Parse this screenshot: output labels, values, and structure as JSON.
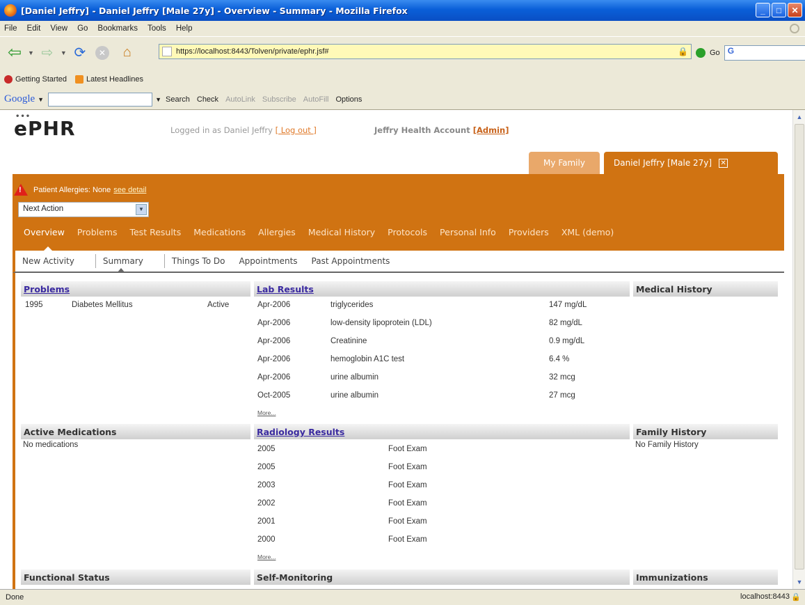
{
  "window": {
    "title": "[Daniel Jeffry] - Daniel Jeffry [Male 27y] - Overview - Summary - Mozilla Firefox",
    "min": "_",
    "max": "□",
    "close": "✕"
  },
  "menu": [
    "File",
    "Edit",
    "View",
    "Go",
    "Bookmarks",
    "Tools",
    "Help"
  ],
  "nav": {
    "url": "https://localhost:8443/Tolven/private/ephr.jsf#",
    "go_label": "Go",
    "search_value": "G"
  },
  "bookmarks": [
    "Getting Started",
    "Latest Headlines"
  ],
  "google_toolbar": {
    "logo": "Google",
    "items": [
      "Search",
      "Check",
      "AutoLink",
      "Subscribe",
      "AutoFill",
      "Options"
    ]
  },
  "app": {
    "logo": "ePHR",
    "logged_in_text": "Logged in as Daniel Jeffry",
    "logout_link": "[ Log out ]",
    "account_text": "Jeffry Health Account",
    "admin_link": "[Admin]",
    "tab_family": "My Family",
    "tab_patient": "Daniel Jeffry [Male 27y]",
    "allergy_text": "Patient Allergies: None",
    "allergy_link": "see detail",
    "next_action": "Next Action",
    "main_nav": [
      "Overview",
      "Problems",
      "Test Results",
      "Medications",
      "Allergies",
      "Medical History",
      "Protocols",
      "Personal Info",
      "Providers",
      "XML (demo)"
    ],
    "sub_nav": [
      "New Activity",
      "Summary",
      "Things To Do",
      "Appointments",
      "Past Appointments"
    ]
  },
  "problems": {
    "heading": "Problems",
    "rows": [
      {
        "year": "1995",
        "name": "Diabetes Mellitus",
        "status": "Active"
      }
    ]
  },
  "lab_results": {
    "heading": "Lab Results",
    "rows": [
      {
        "date": "Apr-2006",
        "test": "triglycerides",
        "value": "147 mg/dL"
      },
      {
        "date": "Apr-2006",
        "test": "low-density lipoprotein (LDL)",
        "value": "82 mg/dL"
      },
      {
        "date": "Apr-2006",
        "test": "Creatinine",
        "value": "0.9 mg/dL"
      },
      {
        "date": "Apr-2006",
        "test": "hemoglobin A1C test",
        "value": "6.4 %"
      },
      {
        "date": "Apr-2006",
        "test": "urine albumin",
        "value": "32 mcg"
      },
      {
        "date": "Oct-2005",
        "test": "urine albumin",
        "value": "27 mcg"
      }
    ],
    "more": "More..."
  },
  "medical_history": {
    "heading": "Medical History"
  },
  "active_medications": {
    "heading": "Active Medications",
    "text": "No medications"
  },
  "radiology": {
    "heading": "Radiology Results",
    "rows": [
      {
        "year": "2005",
        "exam": "Foot Exam"
      },
      {
        "year": "2005",
        "exam": "Foot Exam"
      },
      {
        "year": "2003",
        "exam": "Foot Exam"
      },
      {
        "year": "2002",
        "exam": "Foot Exam"
      },
      {
        "year": "2001",
        "exam": "Foot Exam"
      },
      {
        "year": "2000",
        "exam": "Foot Exam"
      }
    ],
    "more": "More..."
  },
  "family_history": {
    "heading": "Family History",
    "text": "No Family History"
  },
  "functional_status": {
    "heading": "Functional Status"
  },
  "self_monitoring": {
    "heading": "Self-Monitoring"
  },
  "immunizations": {
    "heading": "Immunizations"
  },
  "status": {
    "left": "Done",
    "right": "localhost:8443"
  }
}
